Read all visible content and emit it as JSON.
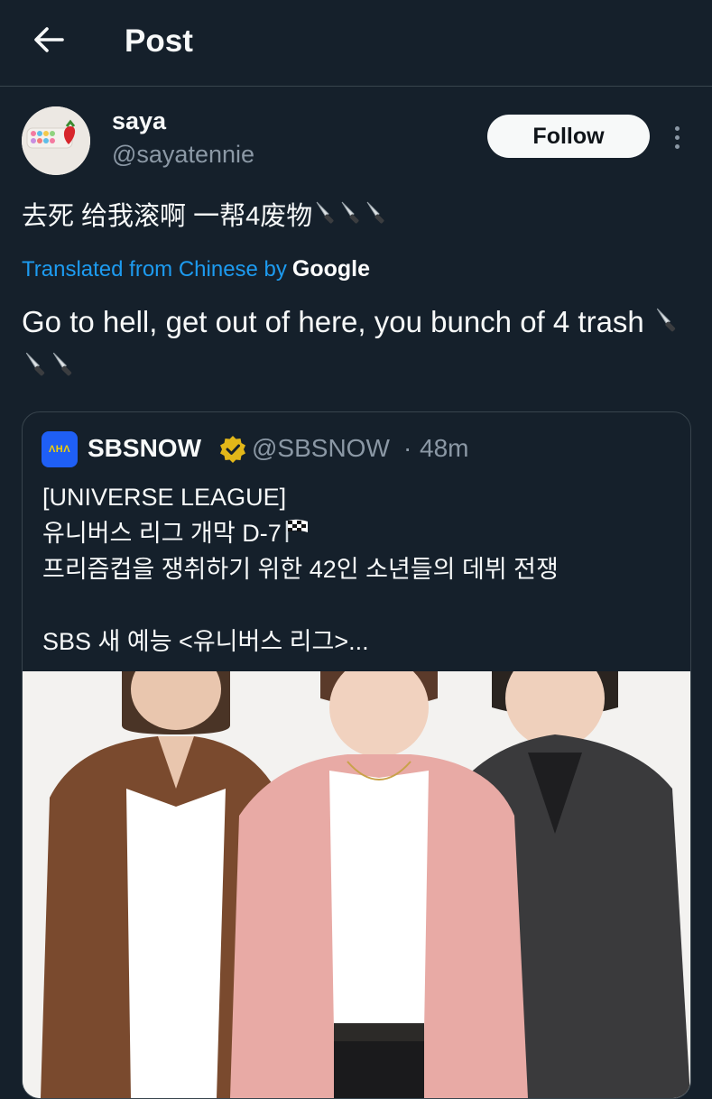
{
  "header": {
    "title": "Post",
    "back_icon": "arrow-left-icon"
  },
  "post": {
    "author": {
      "name": "saya",
      "handle": "@sayatennie"
    },
    "follow_label": "Follow",
    "more_icon": "more-vertical-icon",
    "original_text": "去死 给我滚啊 一帮4废物",
    "emoji_icons": [
      "knife-icon",
      "knife-icon",
      "knife-icon"
    ],
    "translation_note": "Translated from Chinese by",
    "translation_brand": "Google",
    "translated_text": "Go to hell, get out of here, you bunch of 4 trash"
  },
  "quoted_post": {
    "avatar_text": "ΛHΛ",
    "author_name": "SBSNOW",
    "verified_icon": "verified-gold-badge-icon",
    "handle": "@SBSNOW",
    "separator": "·",
    "time": "48m",
    "lines": [
      "[UNIVERSE LEAGUE]",
      "유니버스 리그 개막 D-7",
      "프리즘컵을 쟁취하기 위한 42인 소년들의 데뷔 전쟁",
      "",
      "SBS 새 예능 <유니버스 리그>..."
    ],
    "flag_icon": "checkered-flag-icon",
    "media": "photo of three young men posing"
  },
  "colors": {
    "background": "#15202b",
    "text": "#f7f9f9",
    "secondary_text": "#8b98a5",
    "link": "#1d9bf0",
    "border": "#38444d",
    "verified": "#e2b719"
  }
}
